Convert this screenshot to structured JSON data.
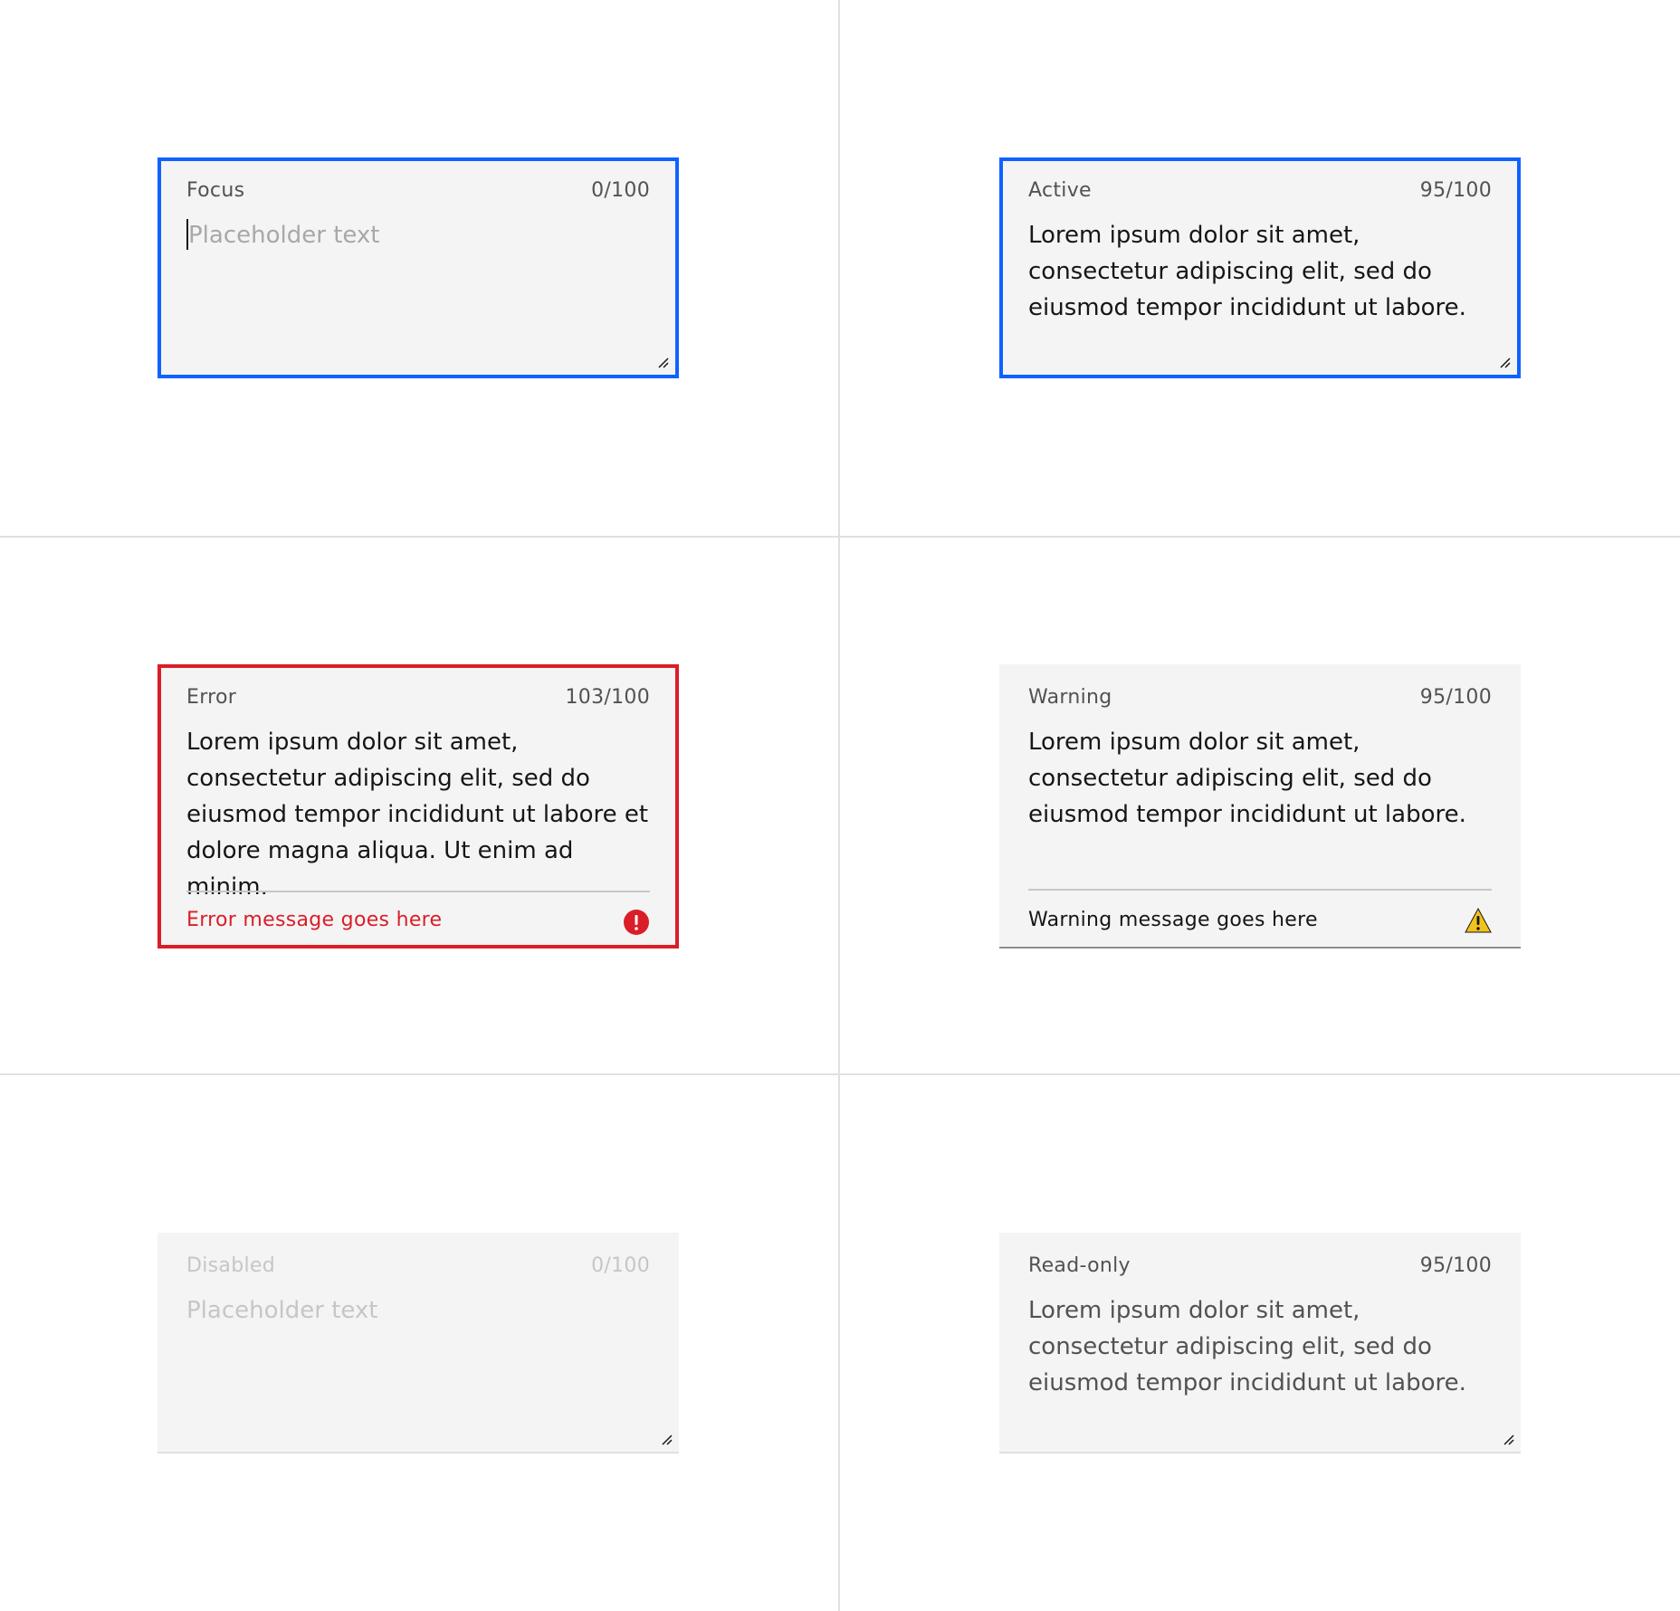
{
  "fields": {
    "focus": {
      "label": "Focus",
      "count": "0/100",
      "placeholder": "Placeholder text"
    },
    "active": {
      "label": "Active",
      "count": "95/100",
      "value": "Lorem ipsum dolor sit amet, consectetur adipiscing elit, sed do eiusmod tempor incididunt ut labore."
    },
    "error": {
      "label": "Error",
      "count": "103/100",
      "value": "Lorem ipsum dolor sit amet, consectetur adipiscing elit, sed do eiusmod tempor incididunt ut labore et dolore magna aliqua. Ut enim ad minim.",
      "message": "Error message goes here"
    },
    "warning": {
      "label": "Warning",
      "count": "95/100",
      "value": "Lorem ipsum dolor sit amet, consectetur adipiscing elit, sed do eiusmod tempor incididunt ut labore.",
      "message": "Warning message goes here"
    },
    "disabled": {
      "label": "Disabled",
      "count": "0/100",
      "placeholder": "Placeholder text"
    },
    "readonly": {
      "label": "Read-only",
      "count": "95/100",
      "value": "Lorem ipsum dolor sit amet, consectetur adipiscing elit, sed do eiusmod tempor incididunt ut labore."
    }
  },
  "colors": {
    "focus_border": "#0f62fe",
    "error": "#da1e28",
    "warning_icon": "#f1c21b",
    "field_background": "#f4f4f4"
  },
  "icons": {
    "error": "error-filled-icon",
    "warning": "warning-alt-filled-icon",
    "resize": "resize-handle-icon"
  }
}
